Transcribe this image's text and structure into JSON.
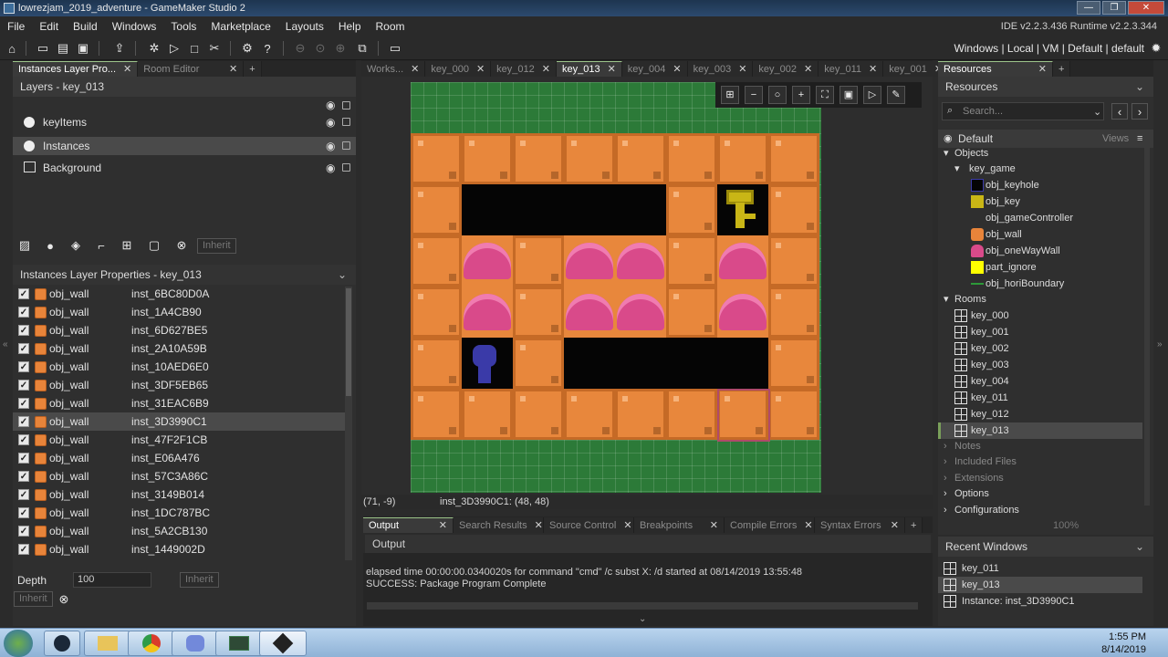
{
  "window": {
    "title": "lowrezjam_2019_adventure - GameMaker Studio 2",
    "buttons": {
      "minimize": "—",
      "maximize": "❐",
      "close": "✕"
    }
  },
  "menu": {
    "items": [
      "File",
      "Edit",
      "Build",
      "Windows",
      "Tools",
      "Marketplace",
      "Layouts",
      "Help",
      "Room"
    ],
    "version": "IDE v2.2.3.436  Runtime v2.2.3.344"
  },
  "toolbar": {
    "targets": "Windows | Local | VM | Default | default"
  },
  "left_panel": {
    "tabs": [
      {
        "label": "Instances Layer Pro...",
        "close": "✕"
      },
      {
        "label": "Room Editor",
        "close": "✕"
      }
    ],
    "plus": "+",
    "layers_header": "Layers - key_013",
    "layers": [
      {
        "name": "keyItems"
      },
      {
        "name": "Instances"
      },
      {
        "name": "Background"
      }
    ],
    "inherit_btn": "Inherit",
    "props_header": "Instances Layer Properties - key_013",
    "instances": [
      {
        "object": "obj_wall",
        "id": "inst_6BC80D0A"
      },
      {
        "object": "obj_wall",
        "id": "inst_1A4CB90"
      },
      {
        "object": "obj_wall",
        "id": "inst_6D627BE5"
      },
      {
        "object": "obj_wall",
        "id": "inst_2A10A59B"
      },
      {
        "object": "obj_wall",
        "id": "inst_10AED6E0"
      },
      {
        "object": "obj_wall",
        "id": "inst_3DF5EB65"
      },
      {
        "object": "obj_wall",
        "id": "inst_31EAC6B9"
      },
      {
        "object": "obj_wall",
        "id": "inst_3D3990C1"
      },
      {
        "object": "obj_wall",
        "id": "inst_47F2F1CB"
      },
      {
        "object": "obj_wall",
        "id": "inst_E06A476"
      },
      {
        "object": "obj_wall",
        "id": "inst_57C3A86C"
      },
      {
        "object": "obj_wall",
        "id": "inst_3149B014"
      },
      {
        "object": "obj_wall",
        "id": "inst_1DC787BC"
      },
      {
        "object": "obj_wall",
        "id": "inst_5A2CB130"
      },
      {
        "object": "obj_wall",
        "id": "inst_1449002D"
      }
    ],
    "depth_label": "Depth",
    "depth_value": "100",
    "depth_inherit": "Inherit",
    "bottom_inherit": "Inherit"
  },
  "editor_tabs": [
    {
      "label": "Works...",
      "close": "✕"
    },
    {
      "label": "key_000",
      "close": "✕"
    },
    {
      "label": "key_012",
      "close": "✕"
    },
    {
      "label": "key_013",
      "close": "✕"
    },
    {
      "label": "key_004",
      "close": "✕"
    },
    {
      "label": "key_003",
      "close": "✕"
    },
    {
      "label": "key_002",
      "close": "✕"
    },
    {
      "label": "key_011",
      "close": "✕"
    },
    {
      "label": "key_001",
      "close": "✕"
    }
  ],
  "editor_plus": "+",
  "status": {
    "coords": "(71, -9)",
    "instance": "inst_3D3990C1: (48, 48)"
  },
  "output": {
    "tabs": [
      {
        "label": "Output",
        "close": "✕"
      },
      {
        "label": "Search Results",
        "close": "✕"
      },
      {
        "label": "Source Control",
        "close": "✕"
      },
      {
        "label": "Breakpoints",
        "close": "✕"
      },
      {
        "label": "Compile Errors",
        "close": "✕"
      },
      {
        "label": "Syntax Errors",
        "close": "✕"
      }
    ],
    "plus": "+",
    "header": "Output",
    "lines": [
      "elapsed time 00:00:00.0340020s for command \"cmd\" /c subst X: /d started at 08/14/2019 13:55:48",
      "SUCCESS: Package Program Complete"
    ]
  },
  "resources": {
    "tab": "Resources",
    "tab_close": "✕",
    "plus": "+",
    "header": "Resources",
    "search_placeholder": "Search...",
    "default_label": "Default",
    "views_label": "Views",
    "objects_label": "Objects",
    "group_label": "key_game",
    "objects": [
      "obj_keyhole",
      "obj_key",
      "obj_gameController",
      "obj_wall",
      "obj_oneWayWall",
      "part_ignore",
      "obj_horiBoundary"
    ],
    "rooms_label": "Rooms",
    "rooms": [
      "key_000",
      "key_001",
      "key_002",
      "key_003",
      "key_004",
      "key_011",
      "key_012",
      "key_013"
    ],
    "other": [
      "Notes",
      "Included Files",
      "Extensions",
      "Options",
      "Configurations"
    ],
    "zoom": "100%"
  },
  "recent": {
    "header": "Recent Windows",
    "items": [
      "key_011",
      "key_013",
      "Instance: inst_3D3990C1"
    ]
  },
  "taskbar": {
    "time": "1:55 PM",
    "date": "8/14/2019"
  },
  "colors": {
    "accent_green": "#9cc48a",
    "wall_orange": "#e8873c",
    "oneway_pink": "#d94a8a",
    "grass_green": "#2c7a38",
    "selection": "#4a4a4a"
  }
}
